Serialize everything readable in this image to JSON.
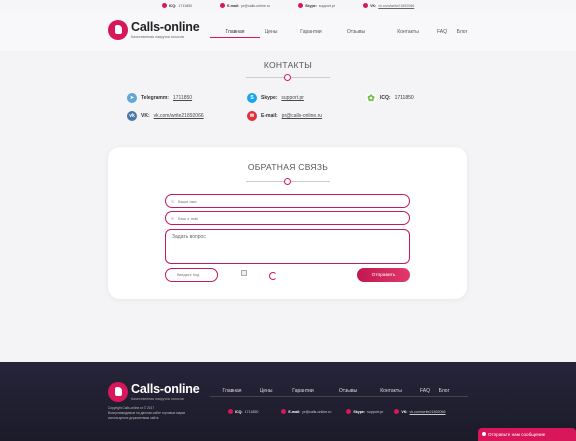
{
  "topbar": {
    "icq_label": "ICQ:",
    "icq_value": "1711850",
    "email_label": "E-mail:",
    "email_value": "pr@calls-online.ru",
    "skype_label": "Skype:",
    "skype_value": "support.pr",
    "vk_label": "VK:",
    "vk_value": "vk.com/write21892066"
  },
  "header": {
    "logo_title": "Calls-online",
    "logo_subtitle": "Качественная накрутка голосов",
    "nav": [
      "Главная",
      "Цены",
      "Гарантии",
      "Отзывы",
      "Контакты",
      "FAQ",
      "Блог"
    ],
    "active_nav": "Главная"
  },
  "contacts": {
    "title": "КОНТАКТЫ",
    "telegram_label": "Telegramm:",
    "telegram_value": "1711850",
    "skype_label": "Skype:",
    "skype_value": "support.pr",
    "icq_label": "ICQ:",
    "icq_value": "1711850",
    "vk_label": "VK:",
    "vk_value": "vk.com/write21892066",
    "email_label": "E-mail:",
    "email_value": "pr@calls-online.ru"
  },
  "feedback": {
    "title": "ОБРАТНАЯ СВЯЗЬ",
    "name_placeholder": "Ваше имя",
    "email_placeholder": "Ваш e-mail",
    "question_placeholder": "Задать вопрос",
    "captcha_placeholder": "Введите Код",
    "send_label": "Отправить"
  },
  "footer": {
    "logo_title": "Calls-online",
    "logo_subtitle": "Качественная накрутка голосов",
    "copyright": "Copyright Calls-online.ru © 2017",
    "notice": "Воспроизводимые на данном сайте торговые марки используются держателями сайта",
    "nav": [
      "Главная",
      "Цены",
      "Гарантии",
      "Отзывы",
      "Контакты",
      "FAQ",
      "Блог"
    ],
    "icq_label": "ICQ:",
    "icq_value": "1711850",
    "email_label": "E-mail:",
    "email_value": "pr@calls-online.ru",
    "skype_label": "Skype:",
    "skype_value": "support.pr",
    "vk_label": "VK:",
    "vk_value": "vk.com/write21892066"
  },
  "chat": {
    "label": "Отправьте нам сообщение"
  },
  "colors": {
    "accent": "#d8175a",
    "footer_bg": "#262438",
    "telegram": "#5fa8d3",
    "skype": "#1ea7e8",
    "icq": "#6bbf3c",
    "vk": "#4a76a8"
  }
}
